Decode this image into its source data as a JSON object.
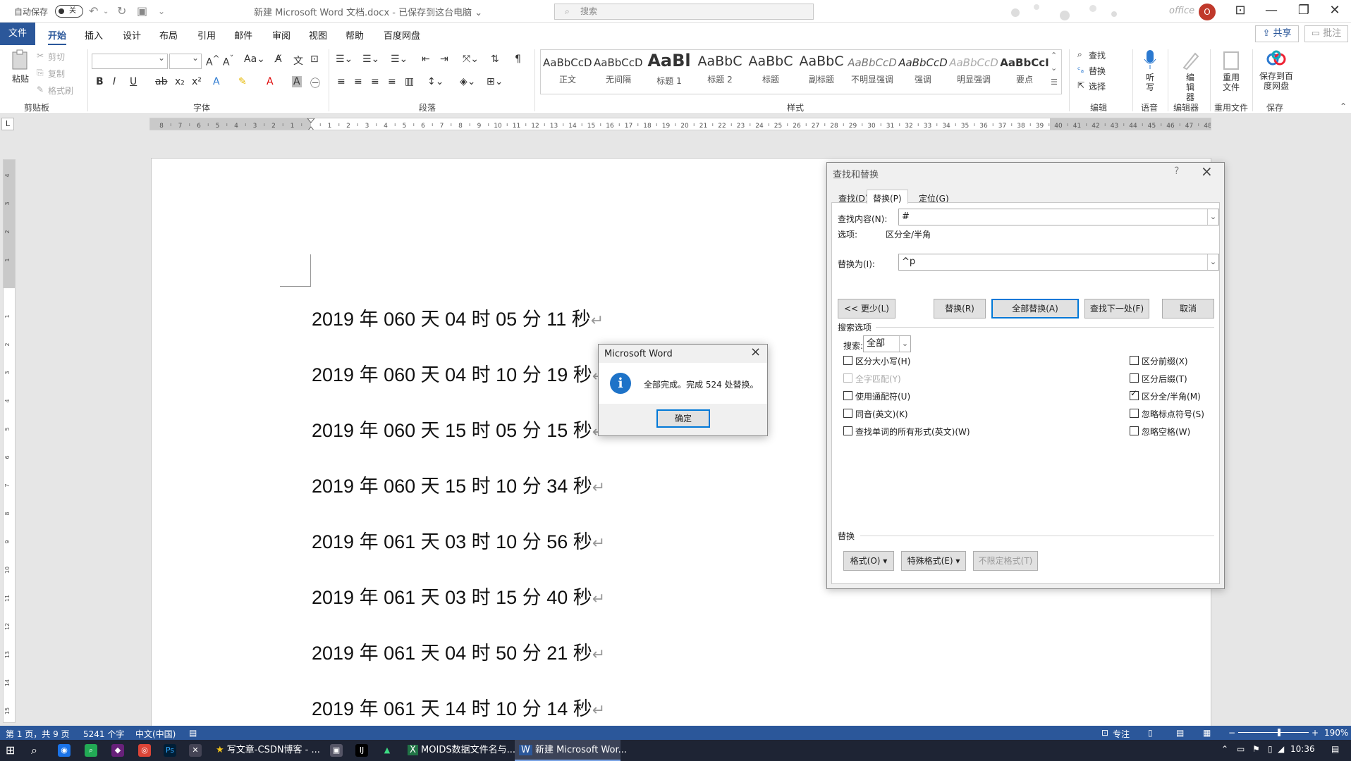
{
  "titlebar": {
    "autosave_label": "自动保存",
    "autosave_state": "关",
    "doc_title": "新建 Microsoft Word 文档.docx - 已保存到这台电脑 ⌄",
    "search_placeholder": "搜索",
    "office_label": "office",
    "avatar_initial": "O"
  },
  "menu": {
    "file": "文件",
    "items": [
      "开始",
      "插入",
      "设计",
      "布局",
      "引用",
      "邮件",
      "审阅",
      "视图",
      "帮助",
      "百度网盘"
    ],
    "share": "共享",
    "comment": "批注"
  },
  "ribbon": {
    "clipboard": {
      "paste": "粘贴",
      "cut": "剪切",
      "copy": "复制",
      "format_painter": "格式刷",
      "label": "剪贴板"
    },
    "font": {
      "label": "字体"
    },
    "paragraph": {
      "label": "段落"
    },
    "styles": {
      "label": "样式",
      "items": [
        {
          "sample": "AaBbCcDd",
          "name": "正文"
        },
        {
          "sample": "AaBbCcDd",
          "name": "无间隔"
        },
        {
          "sample": "AaBl",
          "name": "标题 1"
        },
        {
          "sample": "AaBbC",
          "name": "标题 2"
        },
        {
          "sample": "AaBbC",
          "name": "标题"
        },
        {
          "sample": "AaBbC",
          "name": "副标题"
        },
        {
          "sample": "AaBbCcD",
          "name": "不明显强调"
        },
        {
          "sample": "AaBbCcD",
          "name": "强调"
        },
        {
          "sample": "AaBbCcD",
          "name": "明显强调"
        },
        {
          "sample": "AaBbCcI",
          "name": "要点"
        }
      ]
    },
    "editing": {
      "find": "查找",
      "replace": "替换",
      "select": "选择",
      "label": "编辑"
    },
    "voice": {
      "dictate": "听写",
      "label": "语音"
    },
    "editor": {
      "name": "编辑器",
      "label": "编辑器"
    },
    "reuse": {
      "name": "重用文件",
      "label": "重用文件"
    },
    "save": {
      "name": "保存到百度网盘",
      "label": "保存"
    }
  },
  "document": {
    "lines": [
      "2019 年 060 天 04 时 05 分 11 秒",
      "2019 年 060 天 04 时 10 分 19 秒",
      "2019 年 060 天 15 时 05 分 15 秒",
      "2019 年 060 天 15 时 10 分 34 秒",
      "2019 年 061 天 03 时 10 分 56 秒",
      "2019 年 061 天 03 时 15 分 40 秒",
      "2019 年 061 天 04 时 50 分 21 秒",
      "2019 年 061 天 14 时 10 分 14 秒"
    ],
    "para_mark": "↵"
  },
  "find_replace": {
    "title": "查找和替换",
    "tabs": [
      "查找(D)",
      "替换(P)",
      "定位(G)"
    ],
    "find_label": "查找内容(N):",
    "find_value": "#",
    "options_label": "选项:",
    "options_value": "区分全/半角",
    "replace_label": "替换为(I):",
    "replace_value": "^p",
    "buttons": {
      "less": "<< 更少(L)",
      "replace": "替换(R)",
      "replace_all": "全部替换(A)",
      "find_next": "查找下一处(F)",
      "cancel": "取消"
    },
    "search_options_label": "搜索选项",
    "search_label": "搜索:",
    "search_value": "全部",
    "checkboxes_left": [
      {
        "label": "区分大小写(H)",
        "checked": false,
        "enabled": true
      },
      {
        "label": "全字匹配(Y)",
        "checked": false,
        "enabled": false
      },
      {
        "label": "使用通配符(U)",
        "checked": false,
        "enabled": true
      },
      {
        "label": "同音(英文)(K)",
        "checked": false,
        "enabled": true
      },
      {
        "label": "查找单词的所有形式(英文)(W)",
        "checked": false,
        "enabled": true
      }
    ],
    "checkboxes_right": [
      {
        "label": "区分前缀(X)",
        "checked": false,
        "enabled": true
      },
      {
        "label": "区分后缀(T)",
        "checked": false,
        "enabled": true
      },
      {
        "label": "区分全/半角(M)",
        "checked": true,
        "enabled": true
      },
      {
        "label": "忽略标点符号(S)",
        "checked": false,
        "enabled": true
      },
      {
        "label": "忽略空格(W)",
        "checked": false,
        "enabled": true
      }
    ],
    "replace_section_label": "替换",
    "format_button": "格式(O) ▾",
    "special_button": "特殊格式(E) ▾",
    "no_format_button": "不限定格式(T)"
  },
  "message_box": {
    "title": "Microsoft Word",
    "text": "全部完成。完成 524 处替换。",
    "ok": "确定"
  },
  "statusbar": {
    "page": "第 1 页，共 9 页",
    "words": "5241 个字",
    "language": "中文(中国)",
    "focus": "专注",
    "zoom": "190%"
  },
  "taskbar": {
    "apps": [
      "写文章-CSDN博客 - ...",
      "MOIDS数据文件名与...",
      "新建 Microsoft Wor..."
    ],
    "time": "10:36"
  },
  "colors": {
    "accent": "#2b579a",
    "taskbar": "#1e2434",
    "info_icon": "#1e73c8"
  }
}
